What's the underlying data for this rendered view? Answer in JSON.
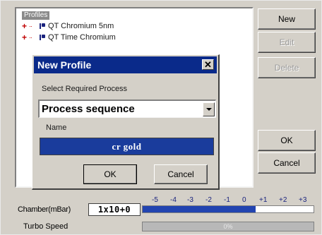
{
  "tree": {
    "root_label": "Profiles",
    "items": [
      {
        "label": "QT Chromium 5nm"
      },
      {
        "label": "QT Time Chromium"
      }
    ]
  },
  "side_buttons": {
    "new": "New",
    "edit": "Edit",
    "delete": "Delete",
    "ok": "OK",
    "cancel": "Cancel"
  },
  "dialog": {
    "title": "New Profile",
    "select_label": "Select Required Process",
    "process_value": "Process sequence",
    "name_label": "Name",
    "name_value": "cr gold",
    "ok_label": "OK",
    "cancel_label": "Cancel"
  },
  "status": {
    "chamber_label": "Chamber(mBar)",
    "chamber_value": "1x10+0",
    "scale_ticks": [
      "-5",
      "-4",
      "-3",
      "-2",
      "-1",
      "0",
      "+1",
      "+2",
      "+3"
    ],
    "pressure_level_fraction": 0.66,
    "turbo_label": "Turbo Speed",
    "turbo_value": "0%"
  },
  "colors": {
    "titlebar": "#0a2a8a",
    "selection": "#1a3c9c",
    "window": "#d4d0c8",
    "bar_fill": "#2244b0"
  }
}
